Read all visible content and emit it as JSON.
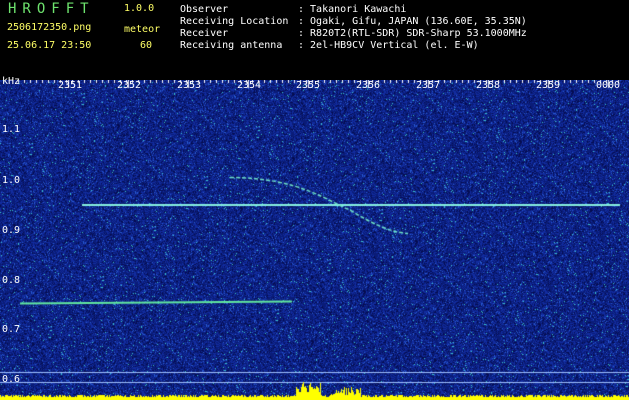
{
  "header": {
    "app_name": "HROFFT",
    "version": "1.0.0",
    "file_name": "2506172350.png",
    "mode_label": "meteor",
    "datetime": "25.06.17 23:50",
    "meteor_count": "60",
    "rows": [
      {
        "label": "Observer",
        "value": ": Takanori Kawachi"
      },
      {
        "label": "Receiving Location",
        "value": ": Ogaki, Gifu, JAPAN (136.60E, 35.35N)"
      },
      {
        "label": "Receiver",
        "value": ": R820T2(RTL-SDR) SDR-Sharp 53.1000MHz"
      },
      {
        "label": "Receiving antenna",
        "value": ": 2el-HB9CV Vertical (el. E-W)"
      }
    ]
  },
  "colors": {
    "background": "#000000",
    "label_green": "#6ee36e",
    "label_yellow": "#ffff66",
    "spectrogram_bg": "#0a1c7a",
    "trace": "#7fffd4",
    "meteor_bar": "#ffff00"
  },
  "axes": {
    "y_unit": "kHz",
    "y_ticks": [
      "1.1",
      "1.0",
      "0.9",
      "0.8",
      "0.7",
      "0.6"
    ],
    "x_ticks": [
      "2351",
      "2352",
      "2353",
      "2354",
      "2355",
      "2356",
      "2357",
      "2358",
      "2359",
      "0000"
    ]
  }
}
